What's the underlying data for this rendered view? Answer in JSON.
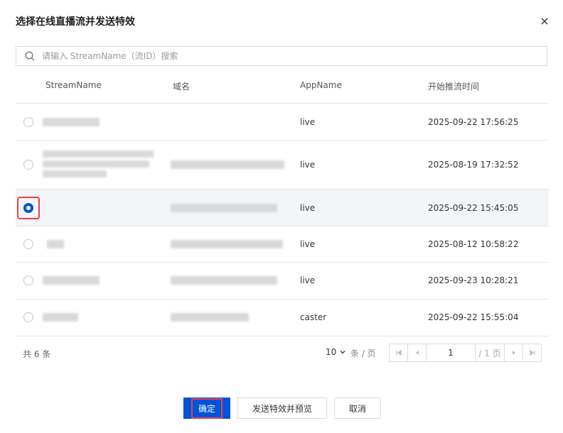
{
  "dialog": {
    "title": "选择在线直播流并发送特效"
  },
  "search": {
    "placeholder": "请输入 StreamName（流ID）搜索",
    "value": ""
  },
  "table": {
    "columns": [
      "StreamName",
      "域名",
      "AppName",
      "开始推流时间"
    ],
    "rows": [
      {
        "app": "live",
        "time": "2025-09-22 17:56:25",
        "selected": false
      },
      {
        "app": "live",
        "time": "2025-08-19 17:32:52",
        "selected": false
      },
      {
        "app": "live",
        "time": "2025-09-22 15:45:05",
        "selected": true
      },
      {
        "app": "live",
        "time": "2025-08-12 10:58:22",
        "selected": false
      },
      {
        "app": "live",
        "time": "2025-09-23 10:28:21",
        "selected": false
      },
      {
        "app": "caster",
        "time": "2025-09-22 15:55:04",
        "selected": false
      }
    ]
  },
  "pagination": {
    "total": "共 6 条",
    "page_size": "10",
    "per_page": "条 / 页",
    "current_page": "1",
    "page_count": "/ 1 页"
  },
  "buttons": {
    "confirm": "确定",
    "send_preview": "发送特效并预览",
    "cancel": "取消"
  },
  "colors": {
    "primary": "#0052d9",
    "highlight": "#e54545",
    "selected_row": "#f3f5f8"
  }
}
